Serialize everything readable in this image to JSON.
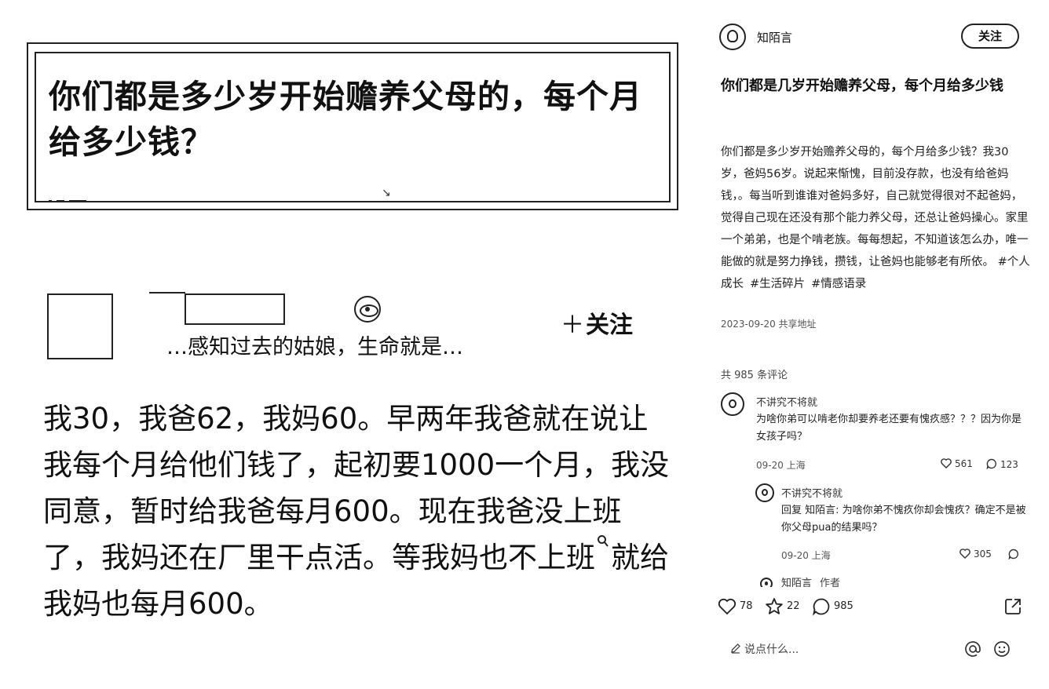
{
  "post_image": {
    "card_title": "你们都是多少岁开始赡养父母的，每个月给多少钱？",
    "author_bio": "…感知过去的姑娘，生命就是…",
    "follow_label": "关注",
    "follow_prefix": "＋",
    "body_before_search": "我30，我爸62，我妈60。早两年我爸就在说让我每个月给他们钱了，起初要1000一个月，我没同意，暂时给我爸每月600。现在我爸没上班了，我妈还在厂里干点活。等我妈也不上班",
    "body_after_search": "就给我妈也每月600。"
  },
  "panel": {
    "author_name": "知陌言",
    "follow_button": "关注",
    "title": "你们都是几岁开始赡养父母，每个月给多少钱",
    "content": "你们都是多少岁开始赡养父母的，每个月给多少钱？我30岁，爸妈56岁。说起来惭愧，目前没存款，也没有给爸妈钱，。每当听到谁谁对爸妈多好，自己就觉得很对不起爸妈，觉得自己现在还没有那个能力养父母，还总让爸妈操心。家里一个弟弟，也是个啃老族。每每想起，不知道该怎么办，唯一能做的就是努力挣钱，攒钱，让爸妈也能够老有所依。",
    "hashtags": [
      "#个人成长",
      "#生活碎片",
      "#情感语录"
    ],
    "meta": "2023-09-20 共享地址",
    "comment_count": "共 985 条评论",
    "comments": [
      {
        "name": "不讲究不将就",
        "text": "为啥你弟可以啃老你却要养老还要有愧疚感？？？因为你是女孩子吗？",
        "meta": "09-20 上海",
        "likes": "561",
        "replies": "123"
      },
      {
        "name": "不讲究不将就",
        "text": "回复 知陌言: 为啥你弟不愧疚你却会愧疚？确定不是被你父母pua的结果吗？",
        "meta": "09-20 上海",
        "likes": "305",
        "replies": ""
      },
      {
        "name": "知陌言",
        "tag": "作者"
      }
    ],
    "actions": {
      "likes": "78",
      "stars": "22",
      "comments": "985"
    },
    "input_placeholder": "说点什么..."
  },
  "icons": [
    "eye-icon",
    "heart-icon",
    "star-icon",
    "comment-icon",
    "share-icon",
    "pencil-icon",
    "at-icon",
    "emoji-icon",
    "search-icon"
  ]
}
